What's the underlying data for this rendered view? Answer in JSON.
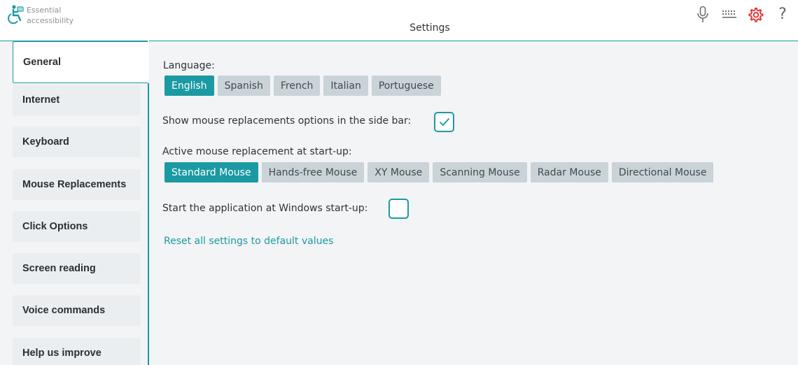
{
  "app": {
    "logo_line1": "Essential",
    "logo_line2": "accessibility",
    "title": "Settings"
  },
  "top_icons": [
    "microphone-icon",
    "keyboard-icon",
    "gear-icon",
    "help-icon"
  ],
  "help_glyph": "?",
  "accent_color": "#1b9aa3",
  "gear_color": "#e0302f",
  "sidebar": {
    "items": [
      {
        "label": "General",
        "active": true
      },
      {
        "label": "Internet"
      },
      {
        "label": "Keyboard"
      },
      {
        "label": "Mouse Replacements"
      },
      {
        "label": "Click Options"
      },
      {
        "label": "Screen reading"
      },
      {
        "label": "Voice commands"
      },
      {
        "label": "Help us improve"
      }
    ]
  },
  "general": {
    "language_label": "Language:",
    "languages": [
      "English",
      "Spanish",
      "French",
      "Italian",
      "Portuguese"
    ],
    "selected_language": "English",
    "show_mouse_label": "Show mouse replacements options in the side bar:",
    "show_mouse_checked": true,
    "active_mouse_label": "Active mouse replacement at start-up:",
    "mouse_options": [
      "Standard Mouse",
      "Hands-free Mouse",
      "XY Mouse",
      "Scanning Mouse",
      "Radar Mouse",
      "Directional Mouse"
    ],
    "selected_mouse": "Standard Mouse",
    "startup_label": "Start the application at Windows start-up:",
    "startup_checked": false,
    "reset_link": "Reset all settings to default values"
  }
}
